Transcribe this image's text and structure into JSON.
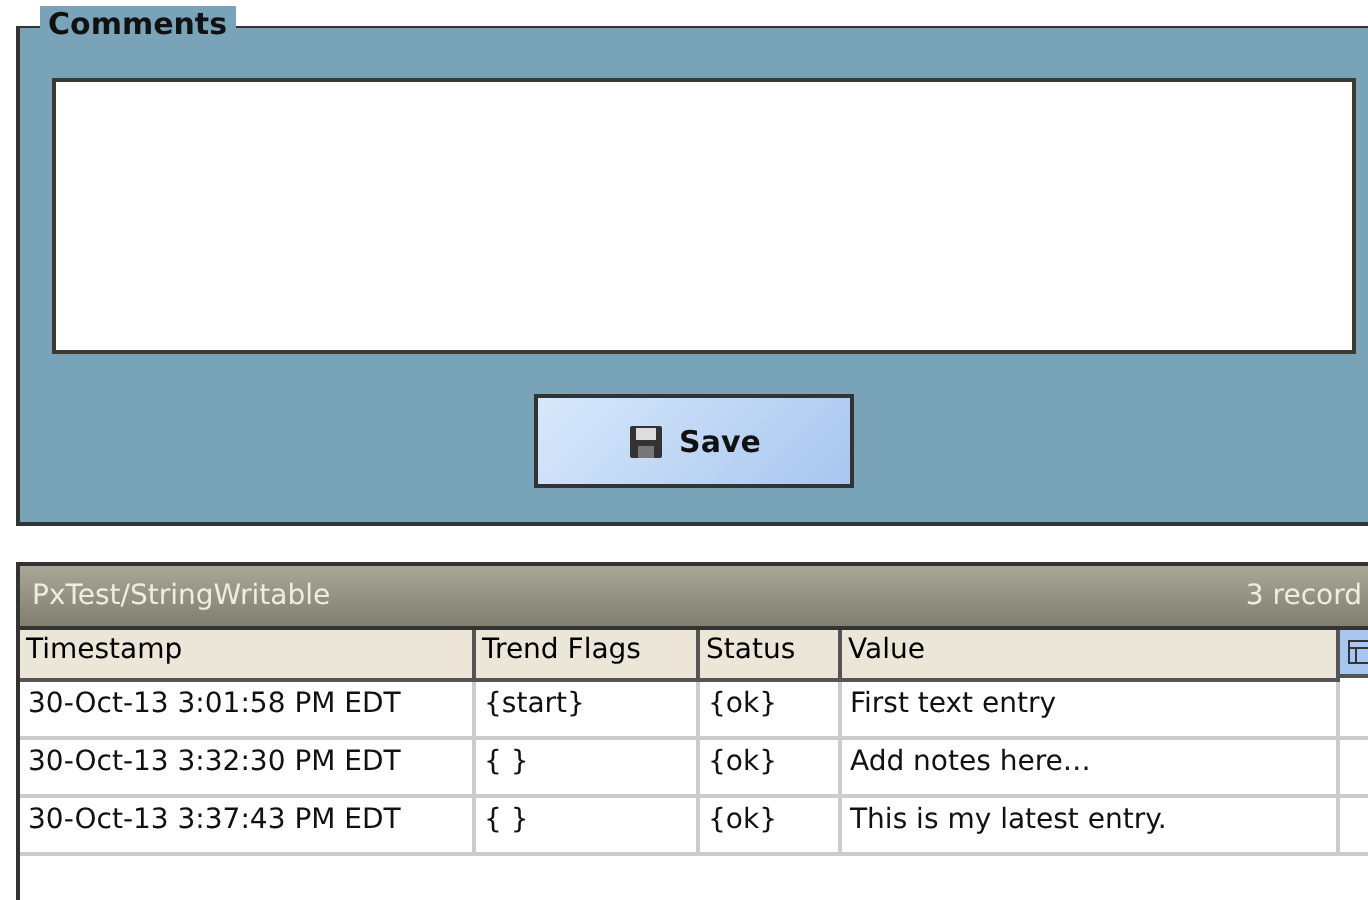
{
  "comments": {
    "legend": "Comments",
    "button": "Save"
  },
  "table": {
    "title": "PxTest/StringWritable",
    "count": "3 record",
    "columns": [
      "Timestamp",
      "Trend Flags",
      "Status",
      "Value"
    ],
    "rows": [
      {
        "cells": [
          "30-Oct-13 3:01:58 PM EDT",
          "{start}",
          "{ok}",
          "First text entry"
        ]
      },
      {
        "cells": [
          "30-Oct-13 3:32:30 PM EDT",
          "{ }",
          "{ok}",
          "Add notes here…"
        ]
      },
      {
        "cells": [
          "30-Oct-13 3:37:43 PM EDT",
          "{ }",
          "{ok}",
          "This is my latest entry."
        ]
      }
    ]
  }
}
